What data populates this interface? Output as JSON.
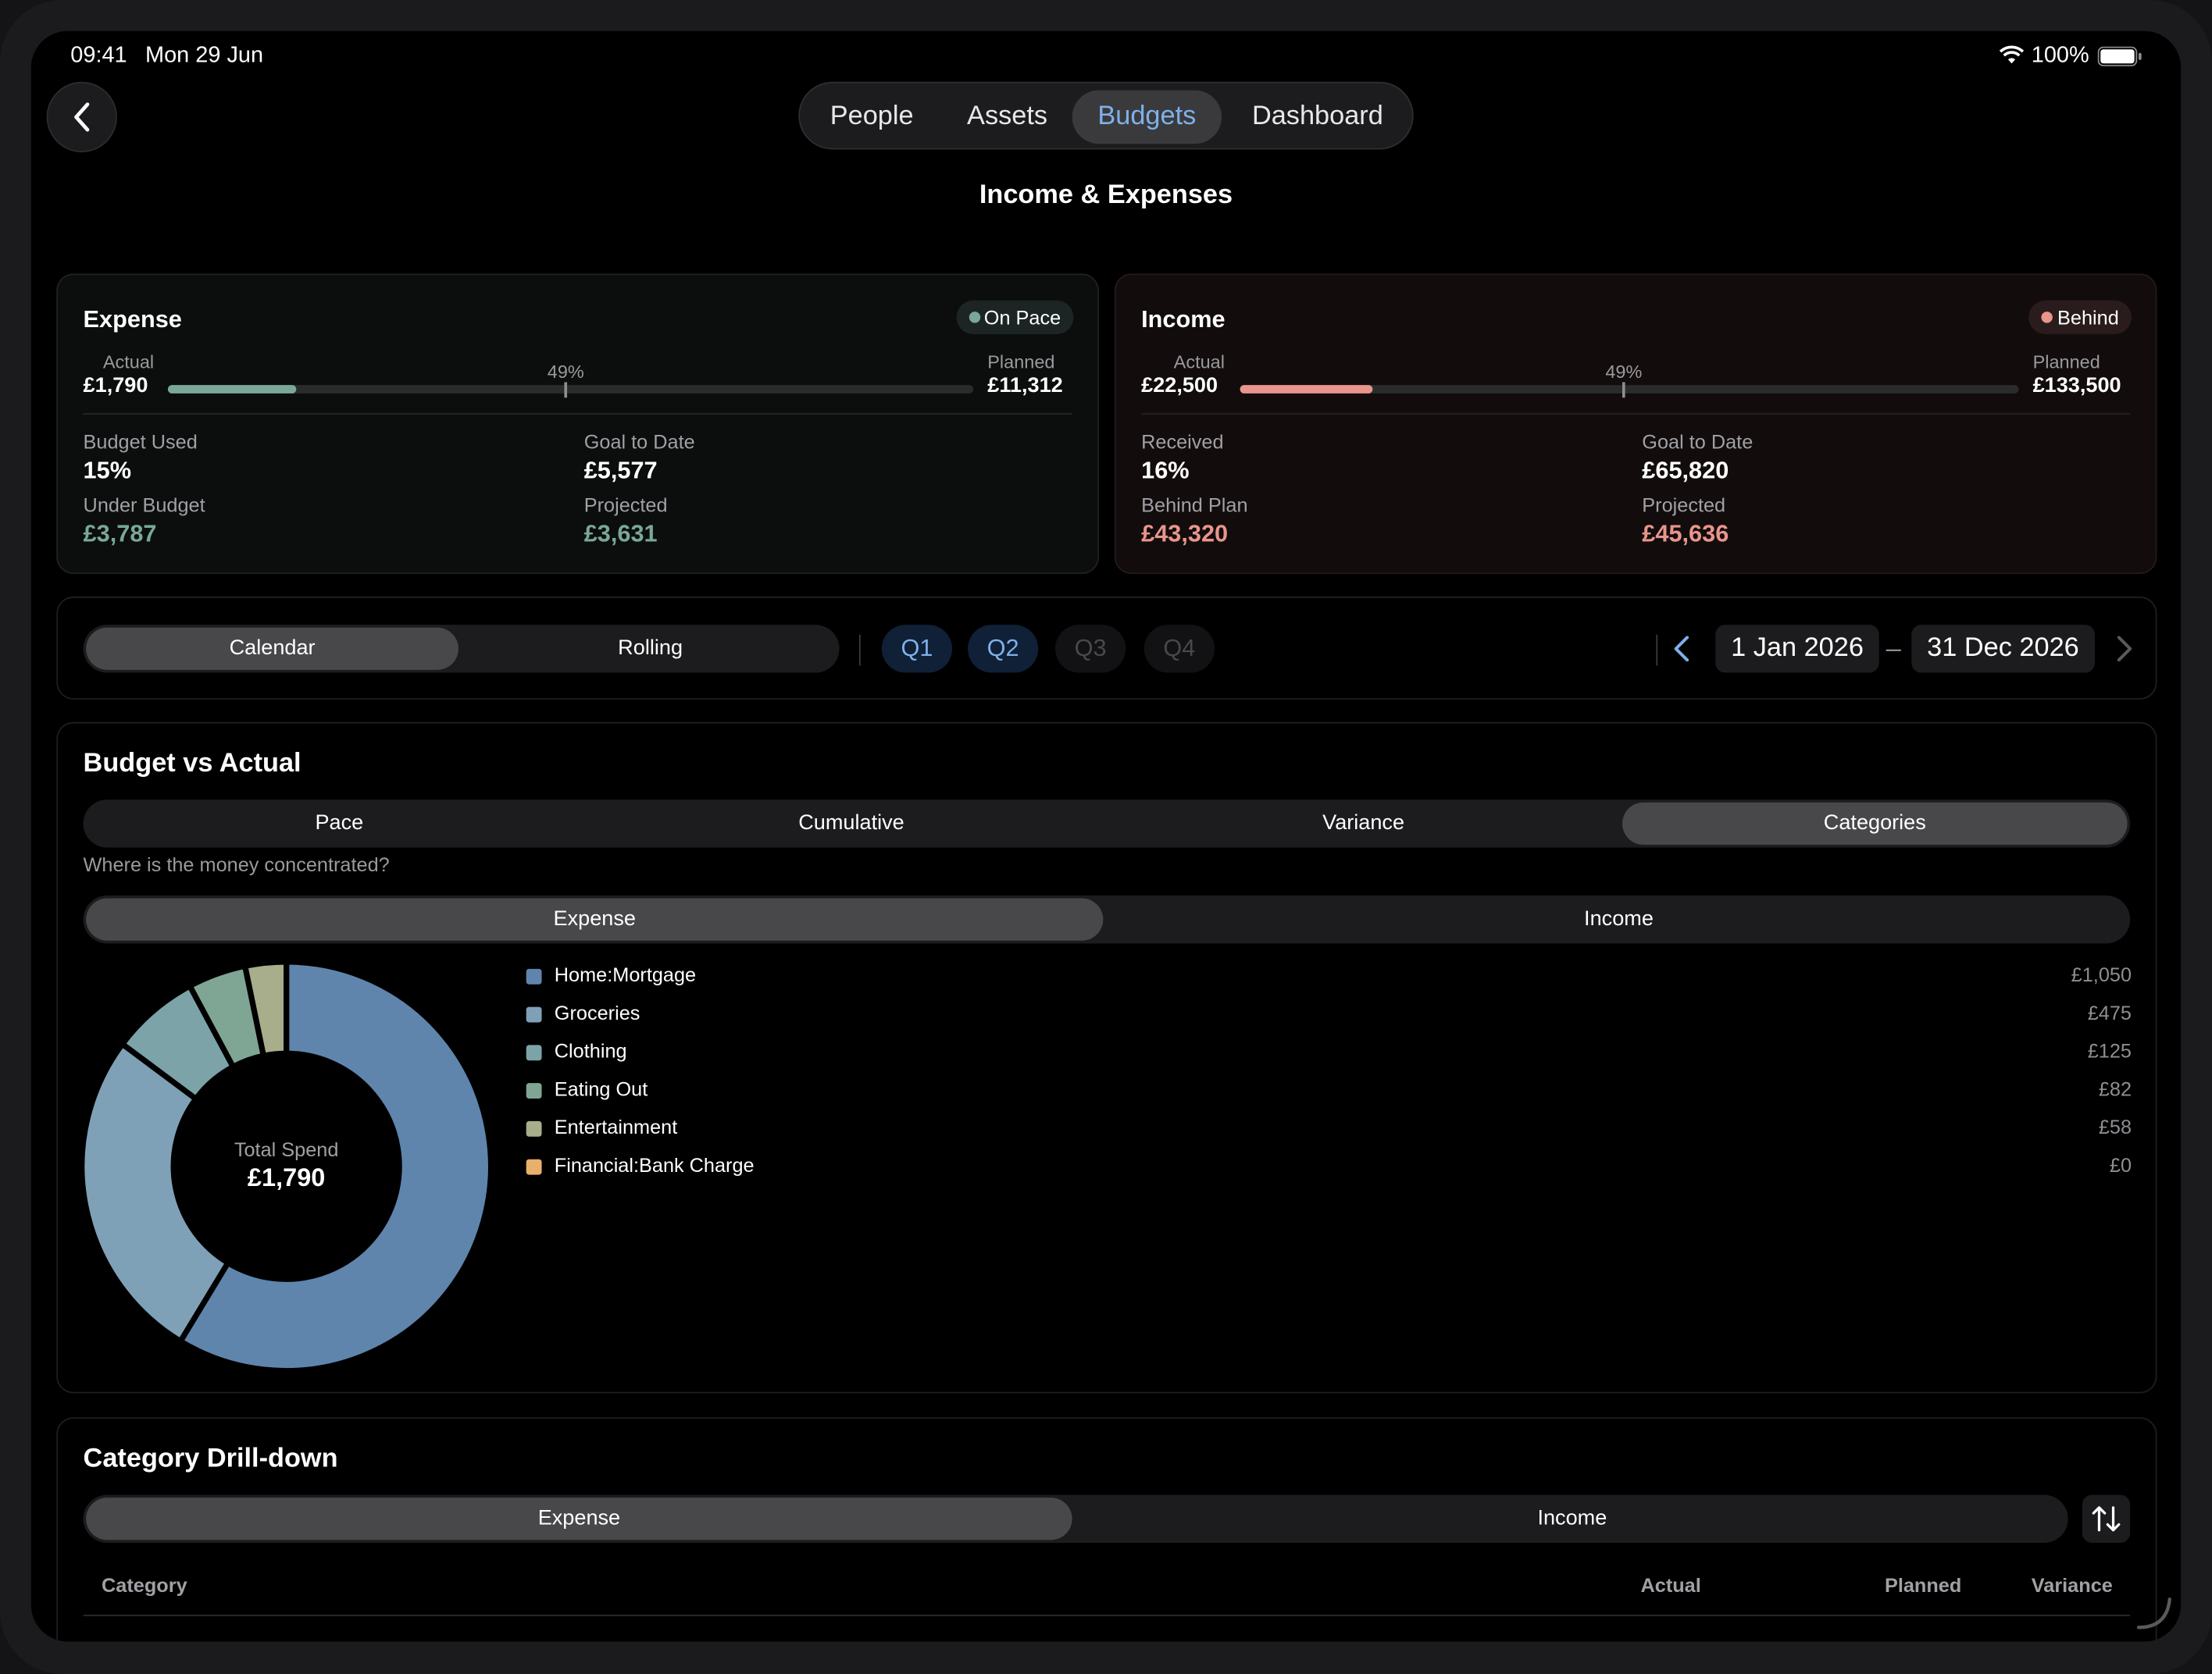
{
  "status_bar": {
    "time": "09:41",
    "date": "Mon 29 Jun",
    "battery": "100%"
  },
  "nav": {
    "tabs": [
      {
        "label": "People",
        "active": false
      },
      {
        "label": "Assets",
        "active": false
      },
      {
        "label": "Budgets",
        "active": true
      },
      {
        "label": "Dashboard",
        "active": false
      }
    ]
  },
  "page_title": "Income & Expenses",
  "expense_card": {
    "title": "Expense",
    "badge": "On Pace",
    "actual_label": "Actual",
    "actual_value": "£1,790",
    "planned_label": "Planned",
    "planned_value": "£11,312",
    "pace_marker": "49%",
    "progress_fraction": 0.16,
    "stats": {
      "budget_used_label": "Budget Used",
      "budget_used_value": "15%",
      "goal_label": "Goal to Date",
      "goal_value": "£5,577",
      "under_label": "Under Budget",
      "under_value": "£3,787",
      "projected_label": "Projected",
      "projected_value": "£3,631"
    }
  },
  "income_card": {
    "title": "Income",
    "badge": "Behind",
    "actual_label": "Actual",
    "actual_value": "£22,500",
    "planned_label": "Planned",
    "planned_value": "£133,500",
    "pace_marker": "49%",
    "progress_fraction": 0.17,
    "stats": {
      "received_label": "Received",
      "received_value": "16%",
      "goal_label": "Goal to Date",
      "goal_value": "£65,820",
      "behind_label": "Behind Plan",
      "behind_value": "£43,320",
      "projected_label": "Projected",
      "projected_value": "£45,636"
    }
  },
  "period": {
    "mode_tabs": [
      {
        "label": "Calendar",
        "active": true
      },
      {
        "label": "Rolling",
        "active": false
      }
    ],
    "quarters": [
      {
        "label": "Q1",
        "state": "selected"
      },
      {
        "label": "Q2",
        "state": "selected"
      },
      {
        "label": "Q3",
        "state": "disabled"
      },
      {
        "label": "Q4",
        "state": "disabled"
      }
    ],
    "start_date": "1 Jan 2026",
    "date_separator": "–",
    "end_date": "31 Dec 2026"
  },
  "budget_vs_actual": {
    "title": "Budget vs Actual",
    "view_tabs": [
      {
        "label": "Pace",
        "active": false
      },
      {
        "label": "Cumulative",
        "active": false
      },
      {
        "label": "Variance",
        "active": false
      },
      {
        "label": "Categories",
        "active": true
      }
    ],
    "subtitle": "Where is the money concentrated?",
    "type_tabs": [
      {
        "label": "Expense",
        "active": true
      },
      {
        "label": "Income",
        "active": false
      }
    ],
    "donut_center_label": "Total Spend",
    "donut_center_value": "£1,790"
  },
  "chart_data": {
    "type": "pie",
    "categories": [
      "Home:Mortgage",
      "Groceries",
      "Clothing",
      "Eating Out",
      "Entertainment",
      "Financial:Bank Charge"
    ],
    "values": [
      1050,
      475,
      125,
      82,
      58,
      0
    ],
    "value_labels": [
      "£1,050",
      "£475",
      "£125",
      "£82",
      "£58",
      "£0"
    ],
    "colors": [
      "#5f85ad",
      "#7fa1b7",
      "#7ba3a8",
      "#7fa595",
      "#a8ad8c",
      "#e8b06a"
    ],
    "donut": true
  },
  "drilldown": {
    "title": "Category Drill-down",
    "type_tabs": [
      {
        "label": "Expense",
        "active": true
      },
      {
        "label": "Income",
        "active": false
      }
    ],
    "columns": [
      "Category",
      "Actual",
      "Planned",
      "Variance"
    ]
  },
  "colors": {
    "accent": "#7fb0ea",
    "on_pace": "#79a898",
    "behind": "#e8958c"
  },
  "icons": {
    "back": "chevron-left-icon",
    "prev": "chevron-left-icon",
    "next": "chevron-right-icon",
    "sort": "sort-arrows-icon",
    "wifi": "wifi-icon",
    "battery": "battery-icon"
  }
}
